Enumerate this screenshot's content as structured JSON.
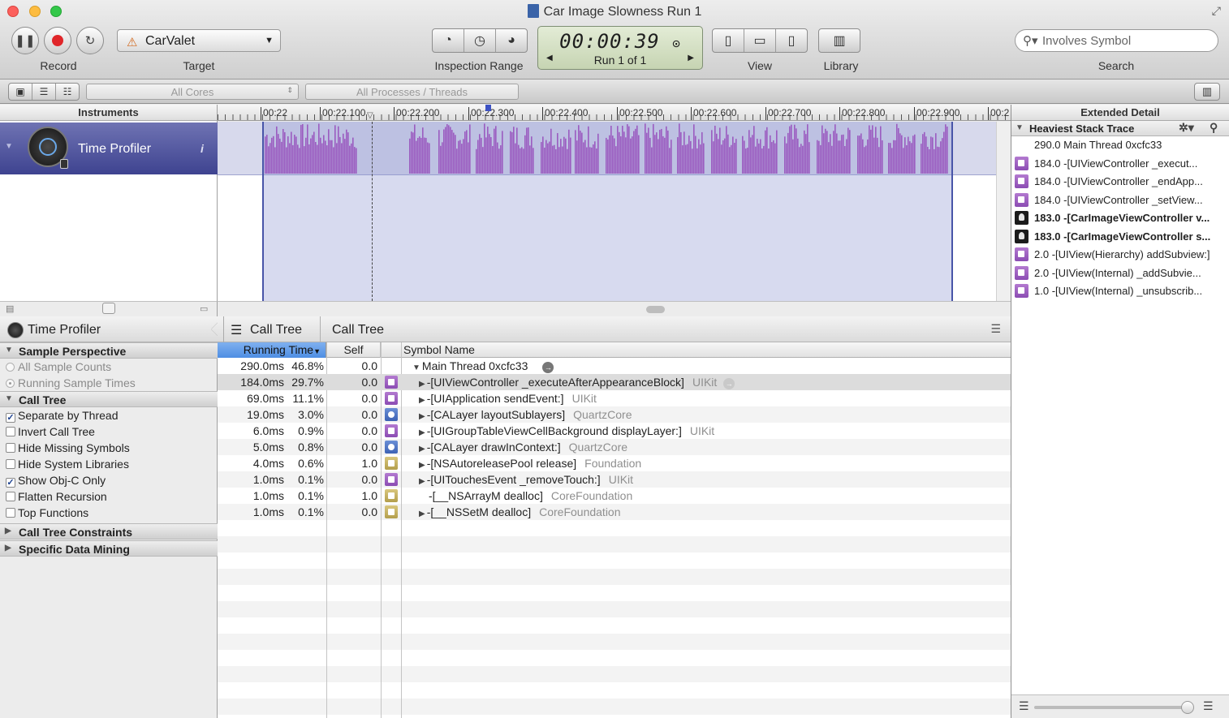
{
  "window": {
    "title": "Car Image Slowness Run 1",
    "colors": {
      "close": "#fc605c",
      "minimize": "#fdbc40",
      "zoom": "#34c84a",
      "selection": "#4e539c",
      "purple": "#9b5cc0"
    }
  },
  "toolbar": {
    "record_label": "Record",
    "target_label": "Target",
    "target_value": "CarValet",
    "inspection_label": "Inspection Range",
    "timer": "00:00:39",
    "run_text": "Run 1 of 1",
    "view_label": "View",
    "library_label": "Library",
    "search_label": "Search",
    "search_placeholder": "Involves Symbol",
    "icons": [
      "pause-icon",
      "record-icon",
      "loop-icon",
      "range-start-icon",
      "range-clock-icon",
      "range-end-icon",
      "view-left-icon",
      "view-bottom-icon",
      "view-right-icon",
      "library-icon",
      "search-icon"
    ]
  },
  "bar2": {
    "cores": "All Cores",
    "processes": "All Processes / Threads"
  },
  "instruments": {
    "header": "Instruments",
    "items": [
      {
        "name": "Time Profiler"
      }
    ]
  },
  "timeline": {
    "ruler_labels": [
      "00:22",
      "00:22.100",
      "00:22.200",
      "00:22.300",
      "00:22.400",
      "00:22.500",
      "00:22.600",
      "00:22.700",
      "00:22.800",
      "00:22.900",
      "00:2"
    ]
  },
  "extended": {
    "header": "Extended Detail",
    "section": "Heaviest Stack Trace",
    "rows": [
      {
        "count": "290.0",
        "text": "Main Thread  0xcfc33",
        "icon": "none"
      },
      {
        "count": "184.0",
        "text": "-[UIViewController _execut...",
        "icon": "framework"
      },
      {
        "count": "184.0",
        "text": "-[UIViewController _endApp...",
        "icon": "framework"
      },
      {
        "count": "184.0",
        "text": "-[UIViewController _setView...",
        "icon": "framework"
      },
      {
        "count": "183.0",
        "text": "-[CarImageViewController v...",
        "icon": "user"
      },
      {
        "count": "183.0",
        "text": "-[CarImageViewController s...",
        "icon": "user"
      },
      {
        "count": "2.0",
        "text": "-[UIView(Hierarchy) addSubview:]",
        "icon": "framework"
      },
      {
        "count": "2.0",
        "text": "-[UIView(Internal) _addSubvie...",
        "icon": "framework"
      },
      {
        "count": "1.0",
        "text": "-[UIView(Internal) _unsubscrib...",
        "icon": "framework"
      }
    ]
  },
  "left_panel": {
    "title": "Time Profiler",
    "sample_perspective": "Sample Perspective",
    "all_sample_counts": "All Sample Counts",
    "running_sample_times": "Running Sample Times",
    "call_tree": "Call Tree",
    "options": [
      {
        "label": "Separate by Thread",
        "checked": true
      },
      {
        "label": "Invert Call Tree",
        "checked": false
      },
      {
        "label": "Hide Missing Symbols",
        "checked": false
      },
      {
        "label": "Hide System Libraries",
        "checked": false
      },
      {
        "label": "Show Obj-C Only",
        "checked": true
      },
      {
        "label": "Flatten Recursion",
        "checked": false
      },
      {
        "label": "Top Functions",
        "checked": false
      }
    ],
    "constraints": "Call Tree Constraints",
    "data_mining": "Specific Data Mining"
  },
  "calltree": {
    "crumb1": "Call Tree",
    "crumb2": "Call Tree",
    "headers": {
      "running": "Running Time",
      "self": "Self",
      "symbol": "Symbol Name"
    },
    "rows": [
      {
        "time": "290.0ms",
        "pct": "46.8%",
        "self": "0.0",
        "symbol": "Main Thread  0xcfc33",
        "lib": "",
        "icon": "none",
        "indent": 0
      },
      {
        "time": "184.0ms",
        "pct": "29.7%",
        "self": "0.0",
        "symbol": "-[UIViewController _executeAfterAppearanceBlock]",
        "lib": "UIKit",
        "icon": "p",
        "indent": 1
      },
      {
        "time": "69.0ms",
        "pct": "11.1%",
        "self": "0.0",
        "symbol": "-[UIApplication sendEvent:]",
        "lib": "UIKit",
        "icon": "p",
        "indent": 1
      },
      {
        "time": "19.0ms",
        "pct": "3.0%",
        "self": "0.0",
        "symbol": "-[CALayer layoutSublayers]",
        "lib": "QuartzCore",
        "icon": "b",
        "indent": 1
      },
      {
        "time": "6.0ms",
        "pct": "0.9%",
        "self": "0.0",
        "symbol": "-[UIGroupTableViewCellBackground displayLayer:]",
        "lib": "UIKit",
        "icon": "p",
        "indent": 1
      },
      {
        "time": "5.0ms",
        "pct": "0.8%",
        "self": "0.0",
        "symbol": "-[CALayer drawInContext:]",
        "lib": "QuartzCore",
        "icon": "b",
        "indent": 1
      },
      {
        "time": "4.0ms",
        "pct": "0.6%",
        "self": "1.0",
        "symbol": "-[NSAutoreleasePool release]",
        "lib": "Foundation",
        "icon": "y",
        "indent": 1
      },
      {
        "time": "1.0ms",
        "pct": "0.1%",
        "self": "0.0",
        "symbol": "-[UITouchesEvent _removeTouch:]",
        "lib": "UIKit",
        "icon": "p",
        "indent": 1
      },
      {
        "time": "1.0ms",
        "pct": "0.1%",
        "self": "1.0",
        "symbol": "-[__NSArrayM dealloc]",
        "lib": "CoreFoundation",
        "icon": "y",
        "indent": 2
      },
      {
        "time": "1.0ms",
        "pct": "0.1%",
        "self": "0.0",
        "symbol": "-[__NSSetM dealloc]",
        "lib": "CoreFoundation",
        "icon": "y",
        "indent": 1
      }
    ]
  }
}
